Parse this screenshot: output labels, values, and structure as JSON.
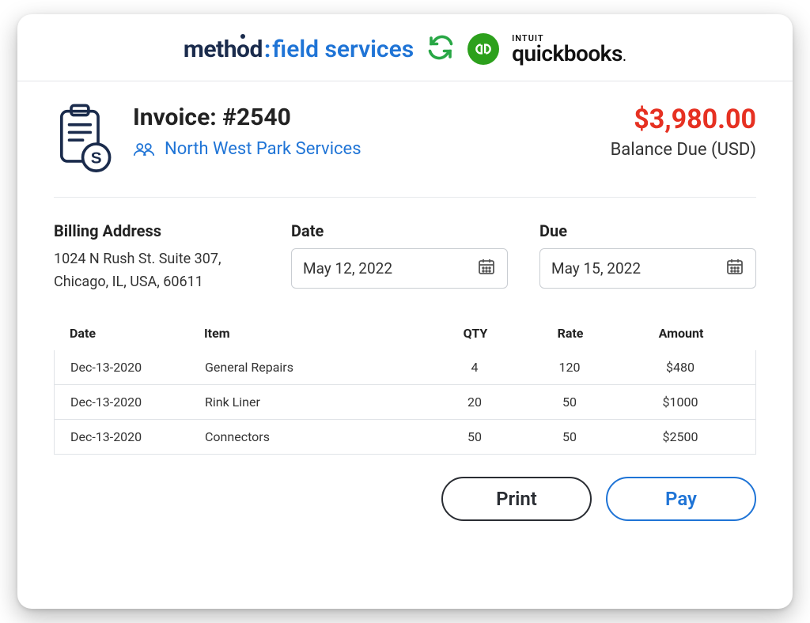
{
  "header": {
    "method": {
      "prefix": "meth",
      "o": "o",
      "suffix": "d",
      "colon": ":",
      "field_services": "field services"
    },
    "quickbooks": {
      "intuit": "INTUIT",
      "word": "quickbooks",
      "dot": "."
    }
  },
  "invoice": {
    "title": "Invoice: #2540",
    "customer": "North West Park Services",
    "balance_amount": "$3,980.00",
    "balance_label": "Balance Due (USD)"
  },
  "meta": {
    "billing_label": "Billing Address",
    "billing_line1": "1024 N Rush St. Suite 307,",
    "billing_line2": "Chicago, IL, USA, 60611",
    "date_label": "Date",
    "date_value": "May 12, 2022",
    "due_label": "Due",
    "due_value": "May 15, 2022"
  },
  "table": {
    "headers": {
      "date": "Date",
      "item": "Item",
      "qty": "QTY",
      "rate": "Rate",
      "amount": "Amount"
    },
    "rows": [
      {
        "date": "Dec-13-2020",
        "item": "General Repairs",
        "qty": "4",
        "rate": "120",
        "amount": "$480"
      },
      {
        "date": "Dec-13-2020",
        "item": "Rink Liner",
        "qty": "20",
        "rate": "50",
        "amount": "$1000"
      },
      {
        "date": "Dec-13-2020",
        "item": "Connectors",
        "qty": "50",
        "rate": "50",
        "amount": "$2500"
      }
    ]
  },
  "actions": {
    "print": "Print",
    "pay": "Pay"
  }
}
